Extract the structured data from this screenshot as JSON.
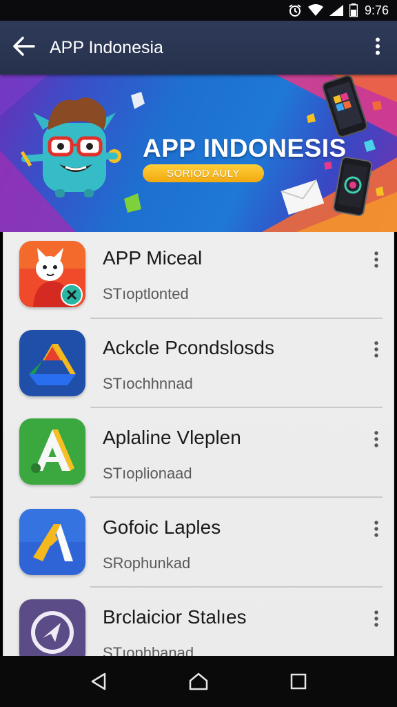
{
  "status_bar": {
    "time": "9:76",
    "icons": [
      "alarm-icon",
      "wifi-icon",
      "signal-icon",
      "battery-icon"
    ]
  },
  "toolbar": {
    "back_icon": "arrow-left-icon",
    "title": "APP Indonesia",
    "overflow_icon": "more-vertical-icon"
  },
  "banner": {
    "title": "APP INDONESIS",
    "pill_text": "SORIOD AULY"
  },
  "apps": [
    {
      "name": "APP Miceal",
      "subtitle": "STıoptlonted",
      "icon": "fox-mascot-icon"
    },
    {
      "name": "Ackcle Pcondslosds",
      "subtitle": "STıochhnnad",
      "icon": "drive-triangle-icon"
    },
    {
      "name": "Aplaline Vleplen",
      "subtitle": "STıoplionaad",
      "icon": "green-a-icon"
    },
    {
      "name": "Gofoic Laples",
      "subtitle": "SRophunkad",
      "icon": "blue-ads-icon"
    },
    {
      "name": "Brclaicior Stalıes",
      "subtitle": "STıophbanad",
      "icon": "purple-circle-icon"
    }
  ],
  "nav_bar": {
    "icons": [
      "back-triangle-icon",
      "home-icon",
      "recents-icon"
    ]
  },
  "colors": {
    "toolbar": "#2e3a58",
    "banner_blue": "#1f78d6",
    "pill_yellow": "#f2a90f",
    "list_bg": "#eeeeee"
  }
}
